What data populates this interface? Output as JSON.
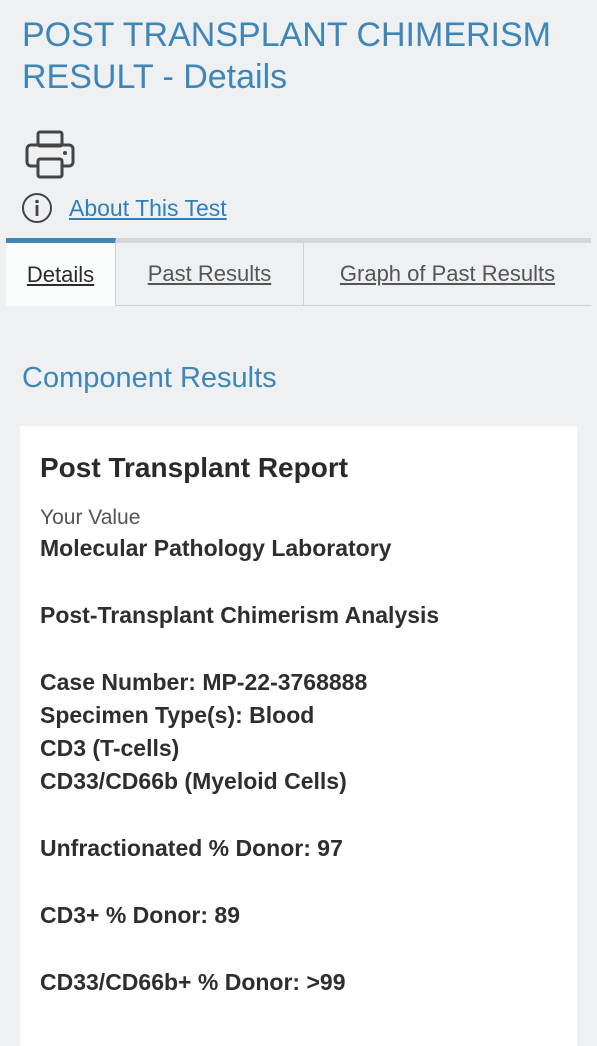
{
  "page": {
    "title": "POST TRANSPLANT CHIMERISM RESULT - Details"
  },
  "toolbar": {
    "print_icon": "print-icon",
    "info_icon": "info-icon",
    "about_label": "About This Test"
  },
  "tabs": [
    {
      "label": "Details",
      "active": true
    },
    {
      "label": "Past Results",
      "active": false
    },
    {
      "label": "Graph of Past Results",
      "active": false
    }
  ],
  "section": {
    "heading": "Component Results"
  },
  "report": {
    "title": "Post Transplant Report",
    "value_label": "Your Value",
    "lines": [
      "Molecular Pathology Laboratory",
      "",
      "Post-Transplant Chimerism Analysis",
      "",
      "Case Number: MP-22-3768888",
      "Specimen Type(s): Blood",
      "CD3 (T-cells)",
      "CD33/CD66b (Myeloid Cells)",
      "",
      "Unfractionated % Donor: 97",
      "",
      "CD3+ % Donor: 89",
      "",
      "CD33/CD66b+ % Donor: >99"
    ]
  },
  "colors": {
    "accent": "#3f86b8",
    "link": "#2f7fb8",
    "background": "#eef0f2",
    "card": "#ffffff"
  }
}
